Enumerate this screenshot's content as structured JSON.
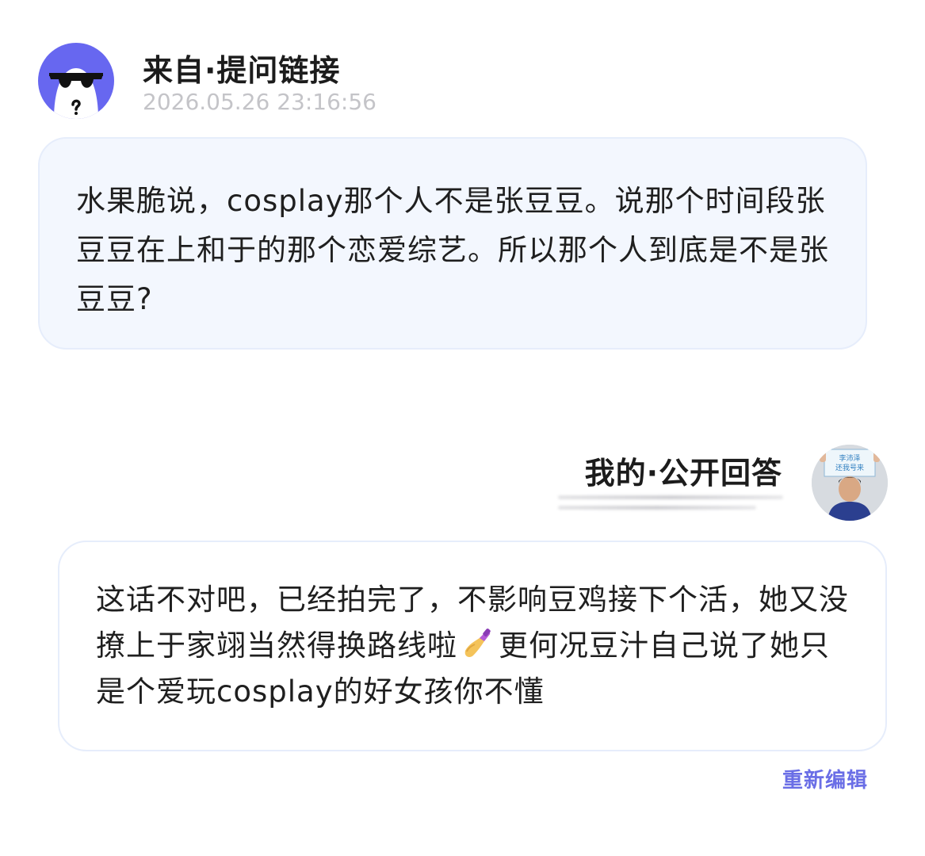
{
  "question": {
    "source_label": "来自·提问链接",
    "timestamp": "2026.05.26 23:16:56",
    "avatar_icon": "sunglasses-ghost-avatar",
    "avatar_color": "#6767f0",
    "text": "水果脆说，cosplay那个人不是张豆豆。说那个时间段张豆豆在上和于的那个恋爱综艺。所以那个人到底是不是张豆豆?"
  },
  "answer": {
    "label": "我的·公开回答",
    "avatar_icon": "user-photo-avatar",
    "avatar_sign_text": "李沛泽 还我号来",
    "text_part1": "这话不对吧，已经拍完了，不影响豆鸡接下个活，她又没撩上于家翊当然得换路线啦",
    "emoji_icon": "nail-polish-icon",
    "text_part2": "更何况豆汁自己说了她只是个爱玩cosplay的好女孩你不懂"
  },
  "actions": {
    "re_edit_label": "重新编辑",
    "accent_color": "#6a6ee6"
  }
}
